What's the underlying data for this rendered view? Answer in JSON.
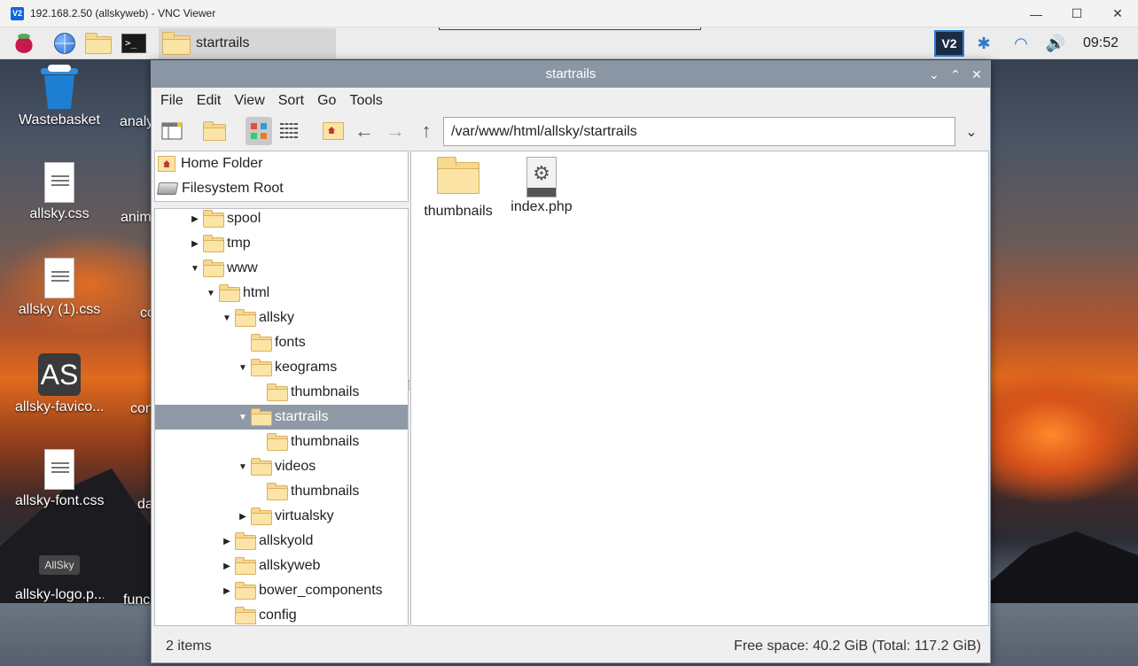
{
  "vnc": {
    "logo": "V2",
    "title": "192.168.2.50 (allskyweb) - VNC Viewer",
    "controls": {
      "minimize": "—",
      "maximize": "☐",
      "close": "✕"
    }
  },
  "taskbar": {
    "task_label": "startrails",
    "terminal_glyph": ">_",
    "tray_vnc": "V2",
    "bluetooth_glyph": "✱",
    "wifi_glyph": "◠",
    "volume_glyph": "🔊",
    "clock": "09:52"
  },
  "desktop": {
    "icons": [
      {
        "label": "Wastebasket"
      },
      {
        "label": "allsky.css"
      },
      {
        "label": "allsky (1).css"
      },
      {
        "label": "allsky-favico...",
        "glyph": "AS"
      },
      {
        "label": "allsky-font.css"
      },
      {
        "label": "allsky-logo.p...",
        "glyph": "AllSky"
      }
    ],
    "partial_labels": [
      "analy",
      "anim",
      "co",
      "con",
      "da",
      "func"
    ]
  },
  "file_manager": {
    "title": "startrails",
    "title_controls": {
      "collapse": "⌄",
      "expand": "⌃",
      "close": "✕"
    },
    "menu": [
      "File",
      "Edit",
      "View",
      "Sort",
      "Go",
      "Tools"
    ],
    "toolbar": {
      "back_glyph": "←",
      "forward_glyph": "→",
      "up_glyph": "↑",
      "path": "/var/www/html/allsky/startrails",
      "dropdown_glyph": "⌄"
    },
    "places": [
      {
        "label": "Home Folder",
        "icon": "home-icon"
      },
      {
        "label": "Filesystem Root",
        "icon": "drive-icon"
      }
    ],
    "tree": [
      {
        "label": "spool",
        "depth": 0,
        "state": "collapsed"
      },
      {
        "label": "tmp",
        "depth": 0,
        "state": "collapsed"
      },
      {
        "label": "www",
        "depth": 0,
        "state": "expanded"
      },
      {
        "label": "html",
        "depth": 1,
        "state": "expanded"
      },
      {
        "label": "allsky",
        "depth": 2,
        "state": "expanded"
      },
      {
        "label": "fonts",
        "depth": 3,
        "state": "leaf"
      },
      {
        "label": "keograms",
        "depth": 3,
        "state": "expanded"
      },
      {
        "label": "thumbnails",
        "depth": 4,
        "state": "leaf"
      },
      {
        "label": "startrails",
        "depth": 3,
        "state": "expanded",
        "selected": true
      },
      {
        "label": "thumbnails",
        "depth": 4,
        "state": "leaf"
      },
      {
        "label": "videos",
        "depth": 3,
        "state": "expanded"
      },
      {
        "label": "thumbnails",
        "depth": 4,
        "state": "leaf"
      },
      {
        "label": "virtualsky",
        "depth": 3,
        "state": "collapsed"
      },
      {
        "label": "allskyold",
        "depth": 2,
        "state": "collapsed"
      },
      {
        "label": "allskyweb",
        "depth": 2,
        "state": "collapsed"
      },
      {
        "label": "bower_components",
        "depth": 2,
        "state": "collapsed"
      },
      {
        "label": "config",
        "depth": 2,
        "state": "leaf"
      }
    ],
    "files": [
      {
        "label": "thumbnails",
        "type": "folder"
      },
      {
        "label": "index.php",
        "type": "php-file"
      }
    ],
    "status": {
      "item_count": "2 items",
      "free_space": "Free space: 40.2 GiB (Total: 117.2 GiB)"
    }
  }
}
